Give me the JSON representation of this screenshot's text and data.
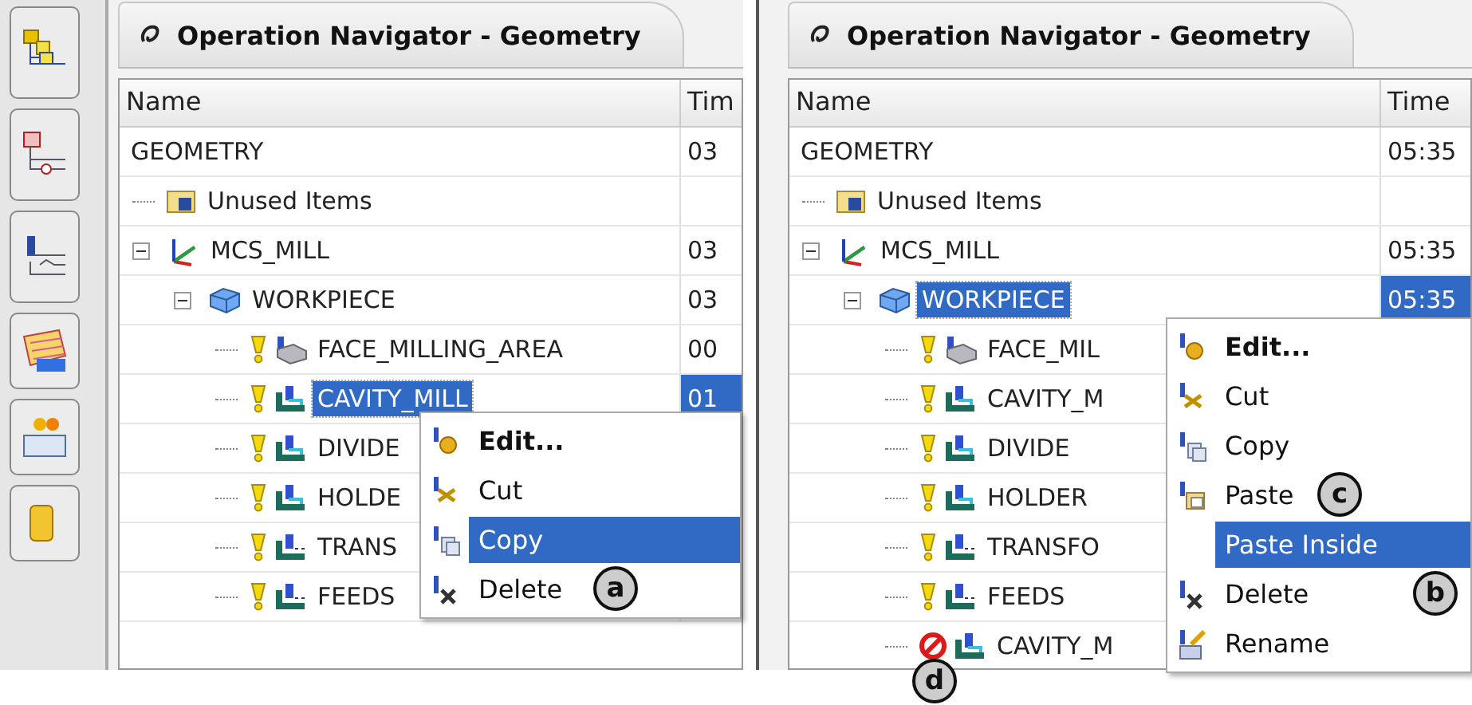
{
  "panels": [
    {
      "toolbar": [
        {
          "kind": "geometry_view"
        },
        {
          "kind": "tool_view"
        },
        {
          "kind": "method_view"
        },
        {
          "kind": "program_view"
        },
        {
          "kind": "machine_view"
        },
        {
          "kind": "part_view"
        }
      ],
      "tab": {
        "title": "Operation Navigator - Geometry"
      },
      "columns": [
        "Name",
        "Tim"
      ],
      "tree": [
        {
          "name": "GEOMETRY",
          "time": "03",
          "selected": false,
          "children": [
            {
              "name": "Unused Items",
              "kind": "folder",
              "selected": false
            },
            {
              "name": "MCS_MILL",
              "time": "03",
              "kind": "mcs",
              "expanded": true,
              "selected": false,
              "children": [
                {
                  "name": "WORKPIECE",
                  "time": "03",
                  "kind": "workpiece",
                  "expanded": true,
                  "selected": false,
                  "children": [
                    {
                      "name": "FACE_MILLING_AREA",
                      "time": "00",
                      "kind": "face_mill",
                      "error": false,
                      "selected": false
                    },
                    {
                      "name": "CAVITY_MILL",
                      "time": "01",
                      "kind": "cavity_mill",
                      "error": false,
                      "selected": true
                    },
                    {
                      "name": "DIVIDE",
                      "kind": "cavity_mill",
                      "error": false,
                      "selected": false
                    },
                    {
                      "name": "HOLDE",
                      "kind": "cavity_mill",
                      "error": false,
                      "selected": false
                    },
                    {
                      "name": "TRANS",
                      "kind": "transform",
                      "error": false,
                      "selected": false
                    },
                    {
                      "name": "FEEDS",
                      "kind": "transform",
                      "error": false,
                      "selected": false
                    }
                  ]
                }
              ]
            }
          ]
        }
      ],
      "context_menu": {
        "items": [
          {
            "label": "Edit...",
            "kind": "edit",
            "bold": true,
            "selected": false
          },
          {
            "label": "Cut",
            "kind": "cut",
            "bold": false,
            "selected": false
          },
          {
            "label": "Copy",
            "kind": "copy",
            "bold": false,
            "selected": true
          },
          {
            "label": "Delete",
            "kind": "delete",
            "bold": false,
            "selected": false
          }
        ]
      },
      "callouts": [
        {
          "label": "a"
        }
      ]
    },
    {
      "tab": {
        "title": "Operation Navigator - Geometry"
      },
      "columns": [
        "Name",
        "Time"
      ],
      "tree": [
        {
          "name": "GEOMETRY",
          "time": "05:35",
          "selected": false,
          "children": [
            {
              "name": "Unused Items",
              "kind": "folder",
              "selected": false
            },
            {
              "name": "MCS_MILL",
              "time": "05:35",
              "kind": "mcs",
              "expanded": true,
              "selected": false,
              "children": [
                {
                  "name": "WORKPIECE",
                  "time": "05:35",
                  "kind": "workpiece",
                  "expanded": true,
                  "selected": true,
                  "children": [
                    {
                      "name": "FACE_MIL",
                      "kind": "face_mill",
                      "error": false,
                      "selected": false
                    },
                    {
                      "name": "CAVITY_M",
                      "kind": "cavity_mill",
                      "error": false,
                      "selected": false
                    },
                    {
                      "name": "DIVIDE",
                      "kind": "cavity_mill",
                      "error": false,
                      "selected": false
                    },
                    {
                      "name": "HOLDER",
                      "kind": "cavity_mill",
                      "error": false,
                      "selected": false
                    },
                    {
                      "name": "TRANSFO",
                      "kind": "transform",
                      "error": false,
                      "selected": false
                    },
                    {
                      "name": "FEEDS",
                      "kind": "transform",
                      "error": false,
                      "selected": false
                    },
                    {
                      "name": "CAVITY_M",
                      "kind": "cavity_mill",
                      "error": true,
                      "selected": false
                    }
                  ]
                }
              ]
            }
          ]
        }
      ],
      "context_menu": {
        "items": [
          {
            "label": "Edit...",
            "kind": "edit",
            "bold": true,
            "selected": false
          },
          {
            "label": "Cut",
            "kind": "cut",
            "bold": false,
            "selected": false
          },
          {
            "label": "Copy",
            "kind": "copy",
            "bold": false,
            "selected": false
          },
          {
            "label": "Paste",
            "kind": "paste",
            "bold": false,
            "selected": false
          },
          {
            "label": "Paste Inside",
            "kind": "none",
            "bold": false,
            "selected": true
          },
          {
            "label": "Delete",
            "kind": "delete",
            "bold": false,
            "selected": false
          },
          {
            "label": "Rename",
            "kind": "rename",
            "bold": false,
            "selected": false
          }
        ]
      },
      "callouts": [
        {
          "label": "c"
        },
        {
          "label": "b"
        },
        {
          "label": "d"
        }
      ]
    }
  ]
}
